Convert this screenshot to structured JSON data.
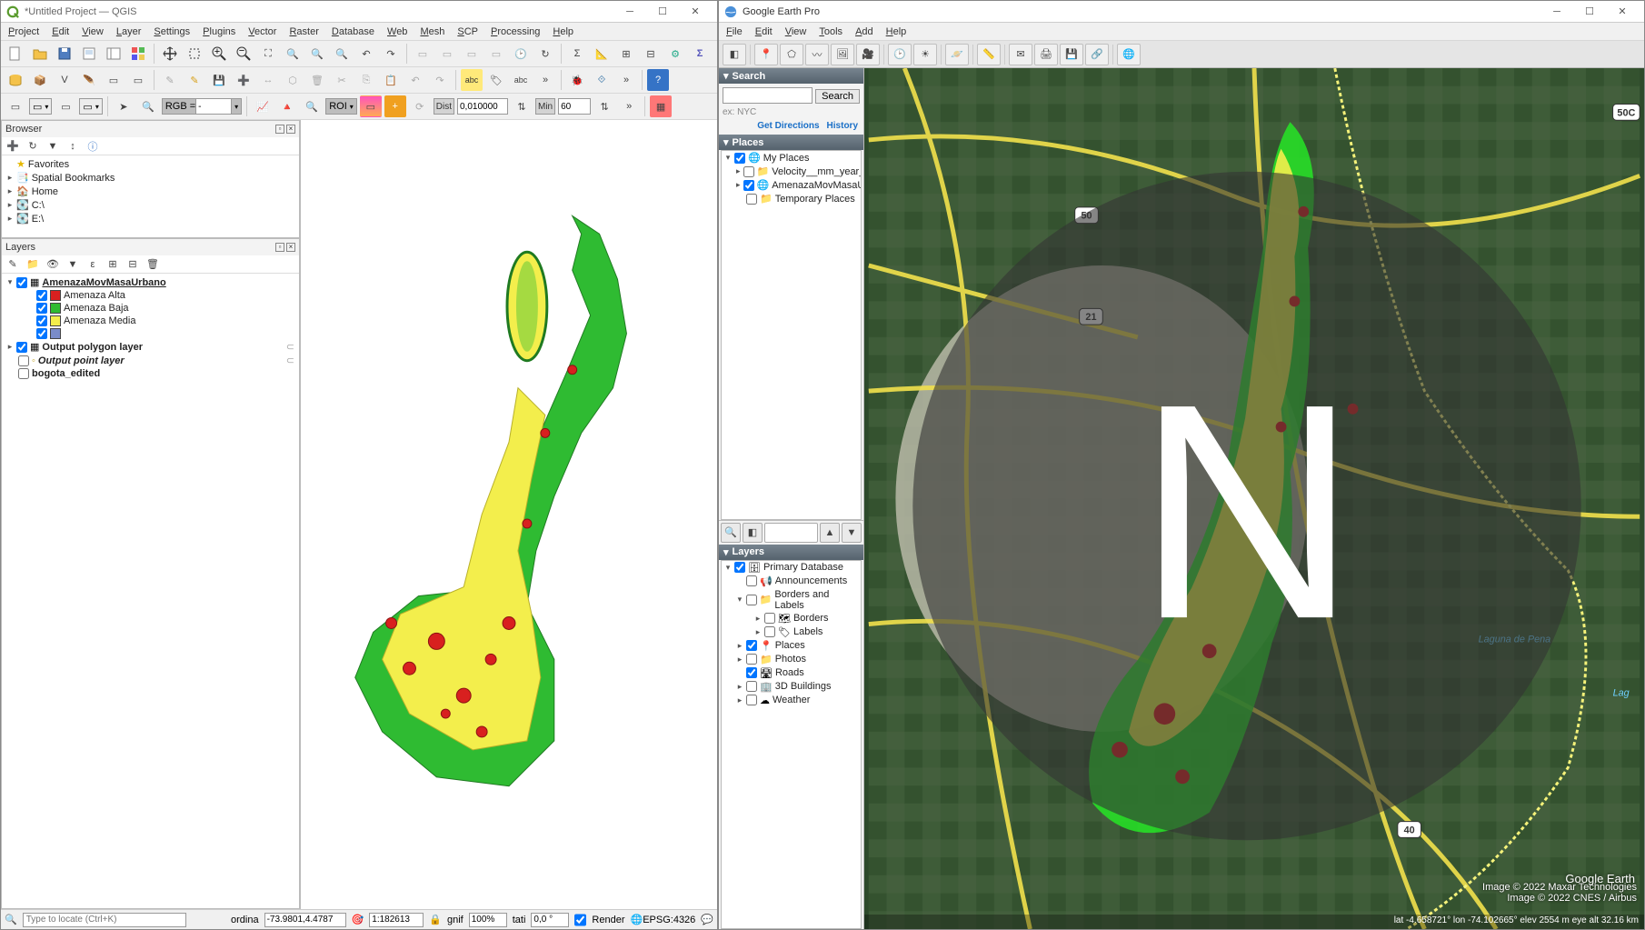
{
  "qgis": {
    "title": "*Untitled Project — QGIS",
    "menu": [
      "Project",
      "Edit",
      "View",
      "Layer",
      "Settings",
      "Plugins",
      "Vector",
      "Raster",
      "Database",
      "Web",
      "Mesh",
      "SCP",
      "Processing",
      "Help"
    ],
    "toolbar3": {
      "rgb_label": "RGB = ",
      "rgb_value": "-",
      "roi_label": "ROI",
      "dist_label": "Dist",
      "dist_value": "0,010000",
      "min_label": "Min",
      "min_value": "60"
    },
    "browser": {
      "title": "Browser",
      "items": [
        "Favorites",
        "Spatial Bookmarks",
        "Home",
        "C:\\",
        "E:\\"
      ]
    },
    "layers": {
      "title": "Layers",
      "root": {
        "name": "AmenazaMovMasaUrbano",
        "legend": [
          {
            "label": "Amenaza Alta",
            "color": "#d8201f"
          },
          {
            "label": "Amenaza Baja",
            "color": "#2fbb32"
          },
          {
            "label": "Amenaza Media",
            "color": "#f3ee4c"
          },
          {
            "label": "",
            "color": "#7a8cc9"
          }
        ]
      },
      "others": [
        {
          "name": "Output polygon layer",
          "checked": true,
          "bold": true
        },
        {
          "name": "Output point layer",
          "checked": false,
          "italic": true
        },
        {
          "name": "bogota_edited",
          "checked": false,
          "bold": true
        }
      ]
    },
    "status": {
      "locator_placeholder": "Type to locate (Ctrl+K)",
      "ordina_label": "ordina",
      "ordina_value": "-73.9801,4.4787",
      "scale_value": "1:182613",
      "mag_label": "gnif",
      "mag_value": "100%",
      "tati_label": "tati",
      "tati_value": "0,0 °",
      "render_label": "Render",
      "crs_value": "EPSG:4326"
    }
  },
  "gep": {
    "title": "Google Earth Pro",
    "menu": [
      "File",
      "Edit",
      "View",
      "Tools",
      "Add",
      "Help"
    ],
    "search": {
      "hdr": "Search",
      "btn": "Search",
      "hint": "ex: NYC",
      "directions": "Get Directions",
      "history": "History"
    },
    "places": {
      "hdr": "Places",
      "my_places": "My Places",
      "items": [
        "Velocity__mm_year__ti...",
        "AmenazaMovMasaUr..."
      ],
      "temp": "Temporary Places"
    },
    "layers": {
      "hdr": "Layers",
      "primary": "Primary Database",
      "items": [
        {
          "name": "Announcements",
          "checked": false
        },
        {
          "name": "Borders and Labels",
          "checked": false,
          "children": [
            {
              "name": "Borders",
              "checked": false
            },
            {
              "name": "Labels",
              "checked": false
            }
          ]
        },
        {
          "name": "Places",
          "checked": true
        },
        {
          "name": "Photos",
          "checked": false
        },
        {
          "name": "Roads",
          "checked": true
        },
        {
          "name": "3D Buildings",
          "checked": false
        },
        {
          "name": "Weather",
          "checked": false
        }
      ]
    },
    "map": {
      "attrib1": "Image © 2022 Maxar Technologies",
      "attrib2": "Image © 2022 CNES / Airbus",
      "logo": "Google Earth",
      "labels": {
        "lake1": "Laguna de Pena",
        "lake2": "Lag"
      },
      "shields": [
        "50",
        "21",
        "40",
        "50C"
      ],
      "status": "lat -4.658721° lon -74.102665° elev 2554 m   eye alt 32.16 km"
    }
  }
}
